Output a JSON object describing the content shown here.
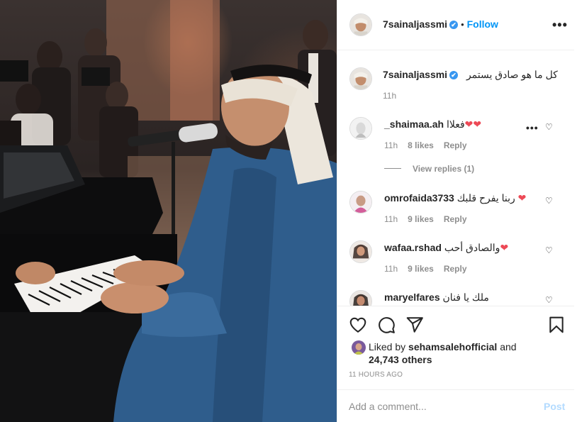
{
  "post": {
    "username": "7sainaljassmi",
    "verified_mark": "✔",
    "separator": "•",
    "follow_label": "Follow",
    "more_label": "•••",
    "caption": {
      "username": "7sainaljassmi",
      "text": "كل ما هو صادق يستمر",
      "time": "11h"
    }
  },
  "comments": [
    {
      "username": "_shaimaa.ah",
      "text": "فعلاا",
      "hearts": "❤❤",
      "time": "11h",
      "likes": "8 likes",
      "reply_label": "Reply",
      "more_label": "•••",
      "view_replies": "View replies (1)"
    },
    {
      "username": "omrofaida3733",
      "text": "ربنا يفرح قلبك",
      "hearts": "❤",
      "time": "11h",
      "likes": "9 likes",
      "reply_label": "Reply"
    },
    {
      "username": "wafaa.rshad",
      "text": "والصادق أحب",
      "hearts": "❤",
      "time": "11h",
      "likes": "9 likes",
      "reply_label": "Reply"
    },
    {
      "username": "maryelfares",
      "text": "ملك يا فنان",
      "hearts": ""
    }
  ],
  "heart_outline_glyph": "♡",
  "likes": {
    "prefix": "Liked by",
    "user": "sehamsalehofficial",
    "conj": "and",
    "others": "24,743 others"
  },
  "timestamp": "11 HOURS AGO",
  "add_comment": {
    "placeholder": "Add a comment...",
    "post_label": "Post"
  },
  "icons": {
    "like": "heart-outline-icon",
    "comment": "comment-bubble-icon",
    "share": "paper-plane-icon",
    "save": "bookmark-icon"
  },
  "colors": {
    "link_blue": "#0095f6",
    "verified_blue": "#3897f0",
    "heart_red": "#ed4956",
    "muted": "#8e8e8e",
    "post_disabled": "#b3dbff"
  }
}
